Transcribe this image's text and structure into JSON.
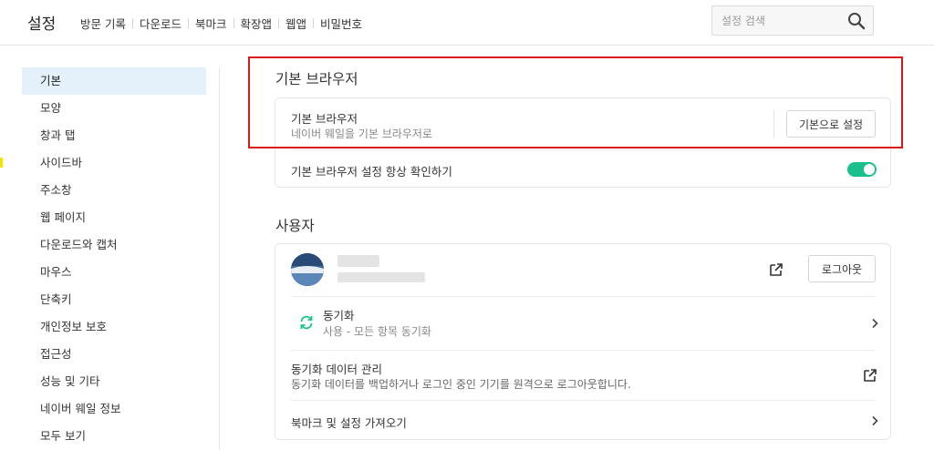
{
  "header": {
    "title": "설정",
    "nav": [
      "방문 기록",
      "다운로드",
      "북마크",
      "확장앱",
      "웹앱",
      "비밀번호"
    ],
    "search_placeholder": "설정 검색"
  },
  "sidebar": {
    "active_index": 0,
    "items": [
      "기본",
      "모양",
      "창과 탭",
      "사이드바",
      "주소창",
      "웹 페이지",
      "다운로드와 캡처",
      "마우스",
      "단축키",
      "개인정보 보호",
      "접근성",
      "성능 및 기타",
      "네이버 웨일 정보",
      "모두 보기"
    ]
  },
  "default_browser": {
    "section_title": "기본 브라우저",
    "row_title": "기본 브라우저",
    "row_subtitle": "네이버 웨일을 기본 브라우저로",
    "set_default_label": "기본으로 설정",
    "check_label": "기본 브라우저 설정 항상 확인하기",
    "check_enabled": true,
    "toggle_color": "#19c08c"
  },
  "user": {
    "section_title": "사용자",
    "logout_label": "로그아웃",
    "sync_title": "동기화",
    "sync_subtitle": "사용 - 모든 항목 동기화",
    "sync_data_title": "동기화 데이터 관리",
    "sync_data_subtitle": "동기화 데이터를 백업하거나 로그인 중인 기기를 원격으로 로그아웃합니다.",
    "import_label": "북마크 및 설정 가져오기"
  },
  "colors": {
    "active_sidebar_bg": "#e4f1fb",
    "highlight_border": "#d81818",
    "sync_icon": "#19c08c"
  }
}
